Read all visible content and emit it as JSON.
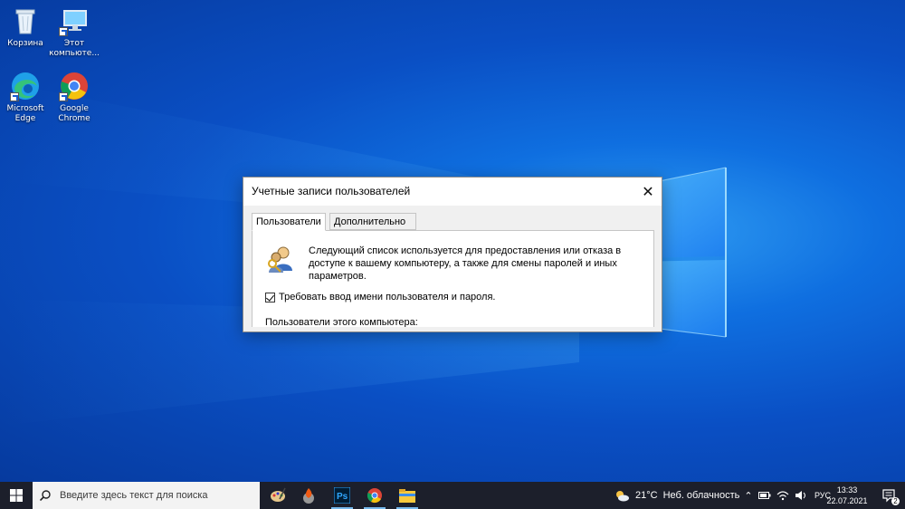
{
  "desktop": {
    "icons": [
      {
        "label": "Корзина"
      },
      {
        "label": "Этот компьюте..."
      },
      {
        "label": "Microsoft Edge"
      },
      {
        "label": "Google Chrome"
      }
    ]
  },
  "dialog": {
    "title": "Учетные записи пользователей",
    "close_glyph": "✕",
    "tabs": [
      {
        "label": "Пользователи",
        "active": true
      },
      {
        "label": "Дополнительно",
        "active": false
      }
    ],
    "info_text": "Следующий список используется для предоставления или отказа в доступе к вашему компьютеру, а также для смены паролей и иных параметров.",
    "require_login_checkbox": {
      "label": "Требовать ввод имени пользователя и пароля.",
      "checked": true
    },
    "users_label": "Пользователи этого компьютера:"
  },
  "taskbar": {
    "search_placeholder": "Введите здесь текст для поиска",
    "weather": {
      "temp": "21°C",
      "condition": "Неб. облачность"
    },
    "language": "РУС",
    "time": "13:33",
    "date": "22.07.2021",
    "notification_count": "2"
  },
  "colors": {
    "taskbar": "#1c1f2b",
    "accent": "#76b9ed",
    "desktop_blue": "#0a4fc4"
  }
}
